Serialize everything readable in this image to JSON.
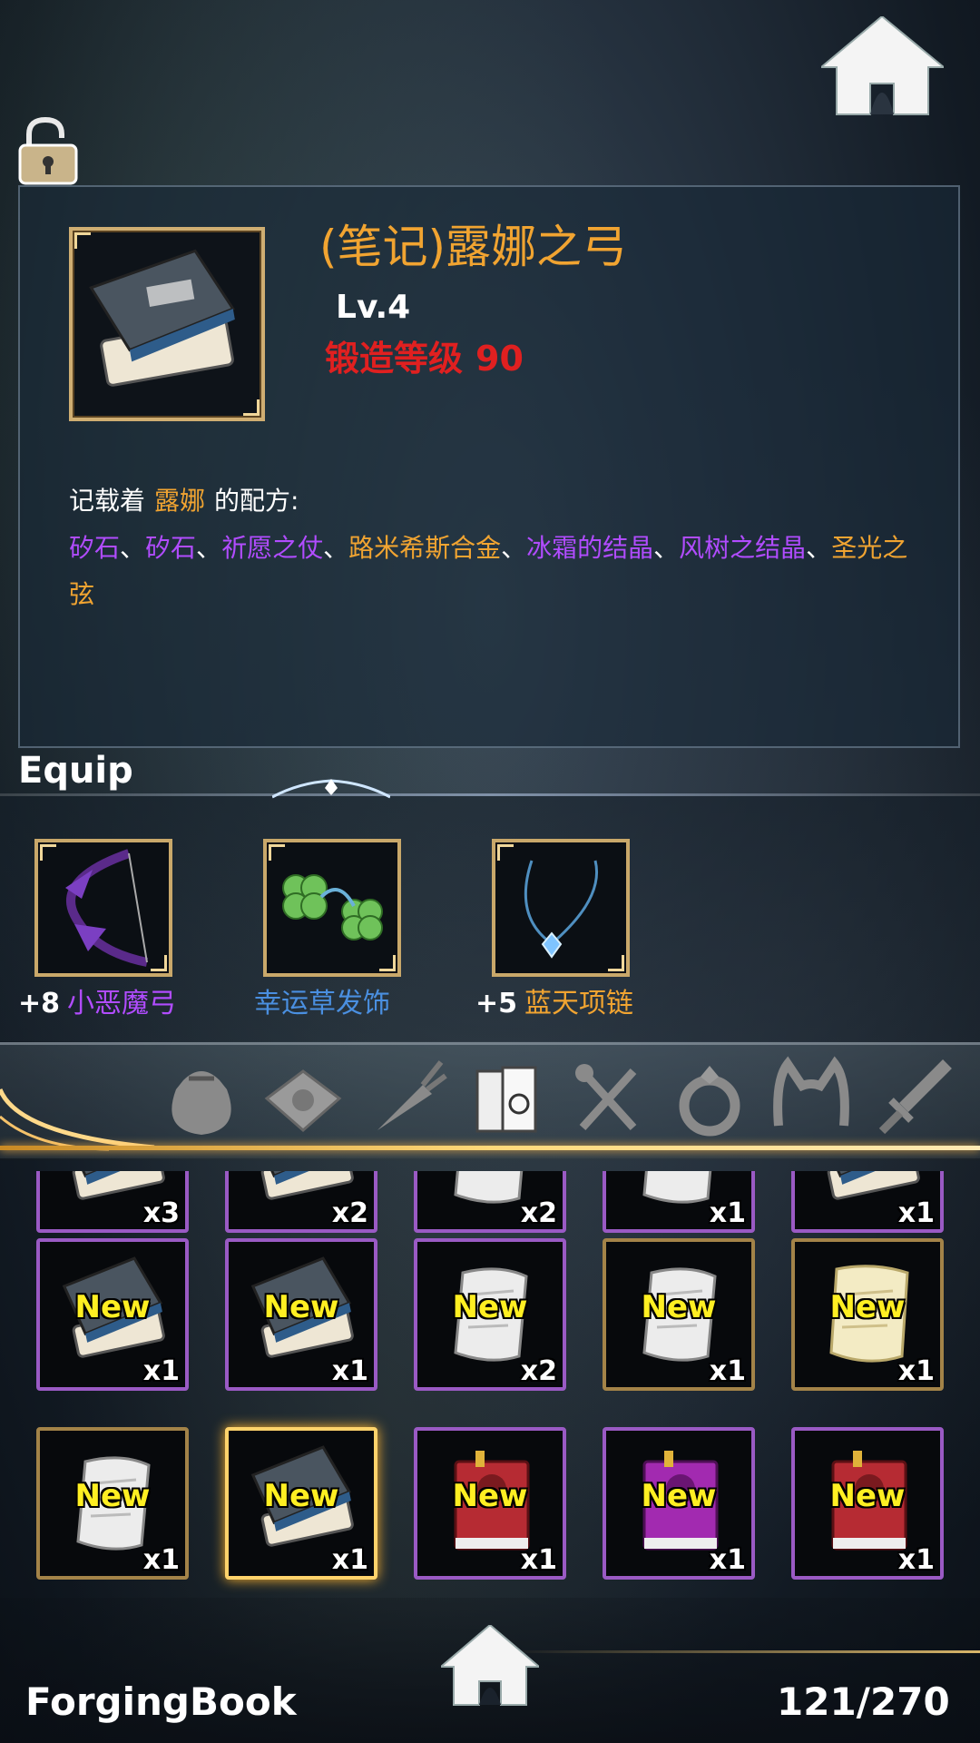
{
  "item_detail": {
    "title": "(笔记)露娜之弓",
    "level": "Lv.4",
    "forge_label": "锻造等级",
    "forge_value": "90",
    "recipe_intro_prefix": "记载着",
    "recipe_owner": "露娜",
    "recipe_intro_suffix": "的配方:",
    "recipe": [
      {
        "name": "矽石",
        "rarity": "purple"
      },
      {
        "name": "矽石",
        "rarity": "purple"
      },
      {
        "name": "祈愿之仗",
        "rarity": "purple"
      },
      {
        "name": "路米希斯合金",
        "rarity": "orange"
      },
      {
        "name": "冰霜的结晶",
        "rarity": "purple"
      },
      {
        "name": "风树之结晶",
        "rarity": "purple"
      },
      {
        "name": "圣光之弦",
        "rarity": "orange"
      }
    ],
    "separator": "、"
  },
  "equip": {
    "title": "Equip",
    "items": [
      {
        "plus": "+8",
        "name": "小恶魔弓",
        "color": "#b14cff",
        "icon": "demon-bow-icon"
      },
      {
        "plus": "",
        "name": "幸运草发饰",
        "color": "#4a8fe0",
        "icon": "clover-hairpin-icon"
      },
      {
        "plus": "+5",
        "name": "蓝天项链",
        "color": "#f1a431",
        "icon": "sky-necklace-icon"
      }
    ]
  },
  "categories": [
    {
      "icon": "bag-icon",
      "active": false
    },
    {
      "icon": "envelope-icon",
      "active": false
    },
    {
      "icon": "carrot-icon",
      "active": false
    },
    {
      "icon": "books-icon",
      "active": true
    },
    {
      "icon": "fork-knife-icon",
      "active": false
    },
    {
      "icon": "ring-icon",
      "active": false
    },
    {
      "icon": "cat-ears-icon",
      "active": false
    },
    {
      "icon": "sword-icon",
      "active": false
    }
  ],
  "inventory": {
    "rows": [
      [
        {
          "badge": "",
          "qty": "x3",
          "frame": "purple",
          "art": "book"
        },
        {
          "badge": "",
          "qty": "x2",
          "frame": "purple",
          "art": "book"
        },
        {
          "badge": "",
          "qty": "x2",
          "frame": "purple",
          "art": "scroll"
        },
        {
          "badge": "",
          "qty": "x1",
          "frame": "purple",
          "art": "scroll"
        },
        {
          "badge": "",
          "qty": "x1",
          "frame": "purple",
          "art": "book"
        }
      ],
      [
        {
          "badge": "New",
          "qty": "x1",
          "frame": "purple",
          "art": "book"
        },
        {
          "badge": "New",
          "qty": "x1",
          "frame": "purple",
          "art": "book"
        },
        {
          "badge": "New",
          "qty": "x2",
          "frame": "purple",
          "art": "scroll"
        },
        {
          "badge": "New",
          "qty": "x1",
          "frame": "gold",
          "art": "scroll"
        },
        {
          "badge": "New",
          "qty": "x1",
          "frame": "gold",
          "art": "scroll-yellow"
        }
      ],
      [
        {
          "badge": "New",
          "qty": "x1",
          "frame": "gold",
          "art": "scroll"
        },
        {
          "badge": "New",
          "qty": "x1",
          "frame": "selected",
          "art": "book"
        },
        {
          "badge": "New",
          "qty": "x1",
          "frame": "purple",
          "art": "red-book"
        },
        {
          "badge": "New",
          "qty": "x1",
          "frame": "purple",
          "art": "magenta-book"
        },
        {
          "badge": "New",
          "qty": "x1",
          "frame": "purple",
          "art": "red-book"
        }
      ]
    ]
  },
  "footer": {
    "page_name": "ForgingBook",
    "count": "121/270"
  }
}
